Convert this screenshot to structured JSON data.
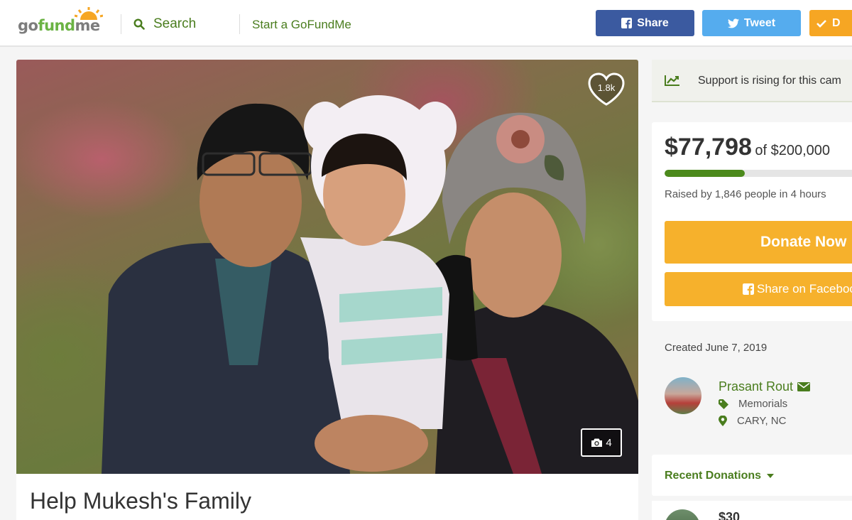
{
  "header": {
    "logo_text_a": "go",
    "logo_text_b": "fund",
    "logo_text_c": "me",
    "search_label": "Search",
    "start_label": "Start a GoFundMe",
    "share_label": "Share",
    "tweet_label": "Tweet",
    "donate_label": "D"
  },
  "campaign": {
    "title": "Help Mukesh's Family",
    "hearts": "1.8k",
    "photo_count": "4"
  },
  "sidebar": {
    "rising_text": "Support is rising for this cam",
    "raised_amount": "$77,798",
    "goal_text": "of $200,000",
    "progress_fraction": 0.389,
    "raised_by": "Raised by 1,846 people in 4 hours",
    "donate_now": "Donate Now",
    "share_facebook": "Share on Facebook",
    "created": "Created June 7, 2019",
    "organizer_name": "Prasant Rout",
    "category": "Memorials",
    "location": "CARY, NC",
    "recent_donations": "Recent Donations",
    "first_donation": "$30"
  },
  "colors": {
    "brand_green": "#4a7d1e",
    "facebook_blue": "#3b5aa0",
    "twitter_blue": "#55acee",
    "donate_orange": "#f6b12c",
    "progress_green": "#4c8a1c"
  }
}
